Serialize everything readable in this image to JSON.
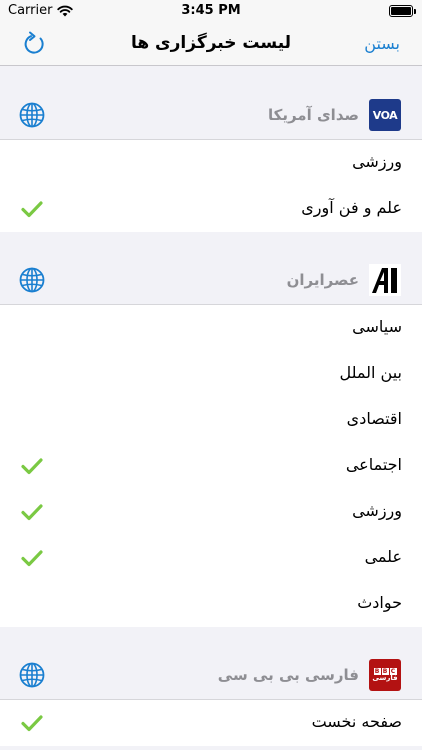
{
  "status_bar": {
    "carrier": "Carrier",
    "time": "3:45 PM"
  },
  "nav": {
    "title": "لیست خبرگزاری ها",
    "close_label": "بستن",
    "accent_color": "#1a7fd0"
  },
  "sources": [
    {
      "name": "صدای آمریکا",
      "logo_text": "VOA",
      "items": [
        {
          "label": "ورزشی",
          "checked": false
        },
        {
          "label": "علم و فن آوری",
          "checked": true
        }
      ]
    },
    {
      "name": "عصرایران",
      "logo_text": "A",
      "items": [
        {
          "label": "سیاسی",
          "checked": false
        },
        {
          "label": "بین الملل",
          "checked": false
        },
        {
          "label": "اقتصادی",
          "checked": false
        },
        {
          "label": "اجتماعی",
          "checked": true
        },
        {
          "label": "ورزشی",
          "checked": true
        },
        {
          "label": "علمی",
          "checked": true
        },
        {
          "label": "حوادث",
          "checked": false
        }
      ]
    },
    {
      "name": "فارسی بی بی سی",
      "logo_text": "BBC",
      "logo_subtext": "فارسی",
      "items": [
        {
          "label": "صفحه نخست",
          "checked": true
        }
      ]
    }
  ]
}
